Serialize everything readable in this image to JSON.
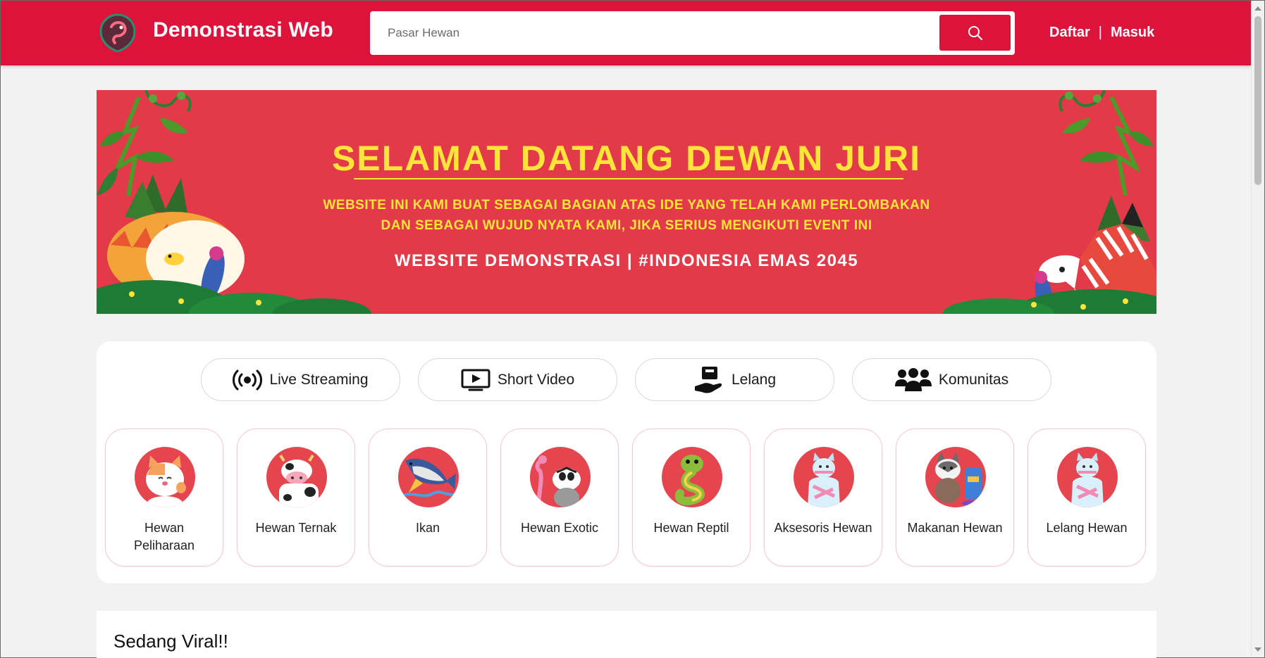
{
  "header": {
    "brand": "Demonstrasi Web",
    "search_placeholder": "Pasar Hewan",
    "register": "Daftar",
    "separator": "|",
    "login": "Masuk"
  },
  "banner": {
    "title": "SELAMAT DATANG DEWAN JURI",
    "line1": "WEBSITE INI KAMI BUAT SEBAGAI BAGIAN ATAS IDE YANG TELAH KAMI PERLOMBAKAN",
    "line2": "DAN SEBAGAI WUJUD NYATA KAMI, JIKA SERIUS MENGIKUTI EVENT INI",
    "subtitle": "WEBSITE DEMONSTRASI | #INDONESIA EMAS 2045"
  },
  "features": [
    {
      "label": "Live Streaming",
      "icon": "broadcast-icon"
    },
    {
      "label": "Short Video",
      "icon": "video-play-icon"
    },
    {
      "label": "Lelang",
      "icon": "auction-hand-icon"
    },
    {
      "label": "Komunitas",
      "icon": "people-group-icon"
    }
  ],
  "categories": [
    {
      "label": "Hewan Peliharaan",
      "icon": "cat-icon"
    },
    {
      "label": "Hewan Ternak",
      "icon": "cow-icon"
    },
    {
      "label": "Ikan",
      "icon": "fish-icon"
    },
    {
      "label": "Hewan Exotic",
      "icon": "exotic-animal-icon"
    },
    {
      "label": "Hewan Reptil",
      "icon": "snake-icon"
    },
    {
      "label": "Aksesoris Hewan",
      "icon": "accessory-cat-icon"
    },
    {
      "label": "Makanan Hewan",
      "icon": "dog-food-icon"
    },
    {
      "label": "Lelang Hewan",
      "icon": "auction-cat-icon"
    }
  ],
  "viral": {
    "title": "Sedang Viral!!"
  },
  "colors": {
    "primary": "#dc143c",
    "banner_bg": "#e23a48",
    "banner_text": "#ffe53a",
    "category_circle": "#e5454f"
  }
}
